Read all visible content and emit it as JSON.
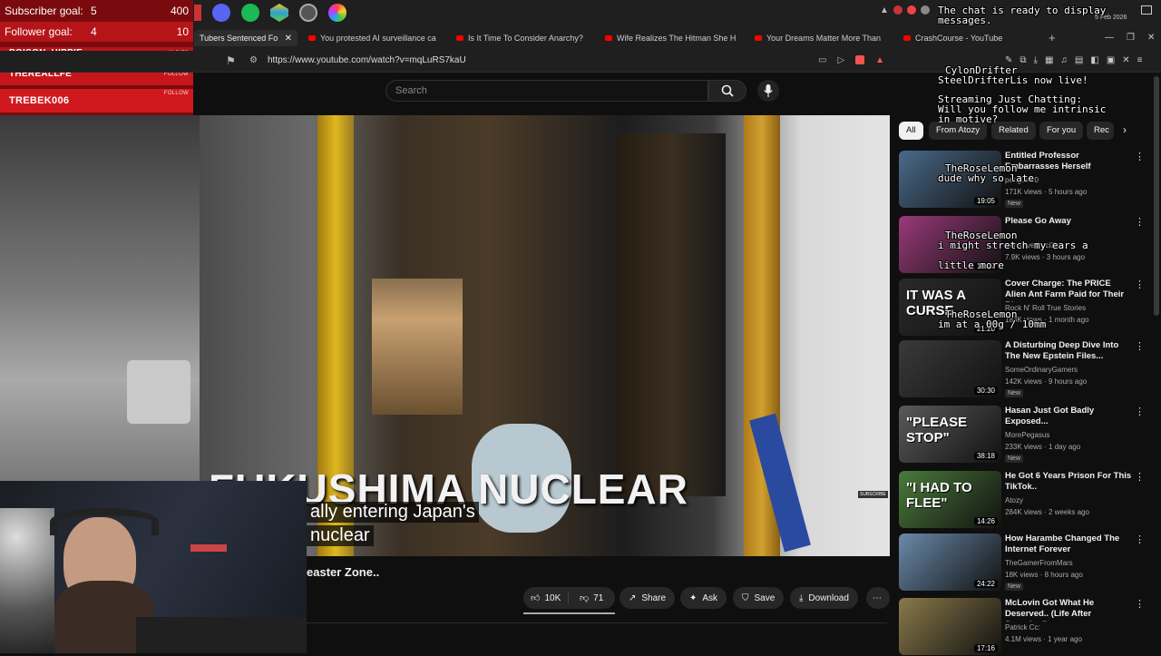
{
  "stream_overlay": {
    "subscriber_goal": {
      "label": "Subscriber goal:",
      "current": "5",
      "target": "400"
    },
    "follower_goal": {
      "label": "Follower goal:",
      "current": "4",
      "target": "10"
    },
    "events": [
      {
        "name": "POISON_HIPPIE",
        "sub": ""
      },
      {
        "name": "THEREALLFE",
        "sub": "FOLLOW"
      },
      {
        "name": "TREBEK006",
        "sub": "FOLLOW"
      }
    ],
    "bits_label": "40 BITS"
  },
  "browser": {
    "tabs": [
      "Tubers Sentenced Fo",
      "You protested AI surveillance ca",
      "Is It Time To Consider Anarchy?",
      "Wife Realizes The Hitman She H",
      "Your Dreams Matter More Than",
      "CrashCourse - YouTube"
    ],
    "url": "https://www.youtube.com/watch?v=mqLuRS7kaU",
    "date": "5 Feb 2026"
  },
  "search": {
    "placeholder": "Search"
  },
  "video": {
    "overlay_title": "FUKUSHIMA NUCLEAR",
    "caption_line1": "ally entering Japan's",
    "caption_line2": "nuclear",
    "subscribe_badge": "SUBSCRIBE",
    "title_fragment": "easter Zone.."
  },
  "actions": {
    "likes": "10K",
    "dislikes": "71",
    "share": "Share",
    "ask": "Ask",
    "save": "Save",
    "download": "Download"
  },
  "chips": [
    "All",
    "From Atozy",
    "Related",
    "For you",
    "Rec"
  ],
  "recommendations": [
    {
      "title": "Entitled Professor Embarrasses Herself",
      "channel": "penguinz0",
      "meta": "171K views · 5 hours ago",
      "duration": "19:05",
      "new": "New",
      "thumb_color": "#4a6a8a"
    },
    {
      "title": "Please Go Away",
      "channel": "Sensitive Soci3ty",
      "meta": "7.9K views · 3 hours ago",
      "duration": "15:17",
      "new": "",
      "thumb_color": "#9a3a7a"
    },
    {
      "title": "Cover Charge: The PRICE Alien Ant Farm Paid for Their Bigges...",
      "channel": "Rock N' Roll True Stories",
      "meta": "183K views · 1 month ago",
      "duration": "21:20",
      "new": "",
      "thumb_color": "#2a2a2a",
      "thumb_text": "IT WAS A CURSE"
    },
    {
      "title": "A Disturbing Deep Dive Into The New Epstein Files...",
      "channel": "SomeOrdinaryGamers",
      "meta": "142K views · 9 hours ago",
      "duration": "30:30",
      "new": "New",
      "thumb_color": "#3a3a3a"
    },
    {
      "title": "Hasan Just Got Badly Exposed...",
      "channel": "MorePegasus",
      "meta": "233K views · 1 day ago",
      "duration": "38:18",
      "new": "New",
      "thumb_color": "#5a5a5a",
      "thumb_text": "\"PLEASE STOP\""
    },
    {
      "title": "He Got 6 Years Prison For This TikTok..",
      "channel": "Atozy",
      "meta": "284K views · 2 weeks ago",
      "duration": "14:26",
      "new": "",
      "thumb_color": "#4a7a3a",
      "thumb_text": "\"I HAD TO FLEE\""
    },
    {
      "title": "How Harambe Changed The Internet Forever",
      "channel": "TheGamerFromMars",
      "meta": "18K views · 8 hours ago",
      "duration": "24:22",
      "new": "New",
      "thumb_color": "#6a8aaa"
    },
    {
      "title": "McLovin Got What He Deserved.. (Life After Superbad)",
      "channel": "Patrick Cc:",
      "meta": "4.1M views · 1 year ago",
      "duration": "17:16",
      "new": "",
      "thumb_color": "#8a7a4a"
    }
  ],
  "chat": [
    {
      "user": "",
      "text": "The chat is ready to display"
    },
    {
      "user": "",
      "text": "messages."
    },
    {
      "user": "CylonDrifter",
      "text": "SteelDrifterLis now live!"
    },
    {
      "user": "",
      "text": "Streaming Just Chatting:"
    },
    {
      "user": "",
      "text": "Will you follow me intrinsic"
    },
    {
      "user": "",
      "text": "in motive?"
    },
    {
      "user": "TheRoseLemon",
      "text": "dude why so late"
    },
    {
      "user": "TheRoseLemon",
      "text": "i might stretch my ears a"
    },
    {
      "user": "",
      "text": "little more"
    },
    {
      "user": "TheRoseLemon",
      "text": "im at a 00g / 10mm"
    }
  ]
}
